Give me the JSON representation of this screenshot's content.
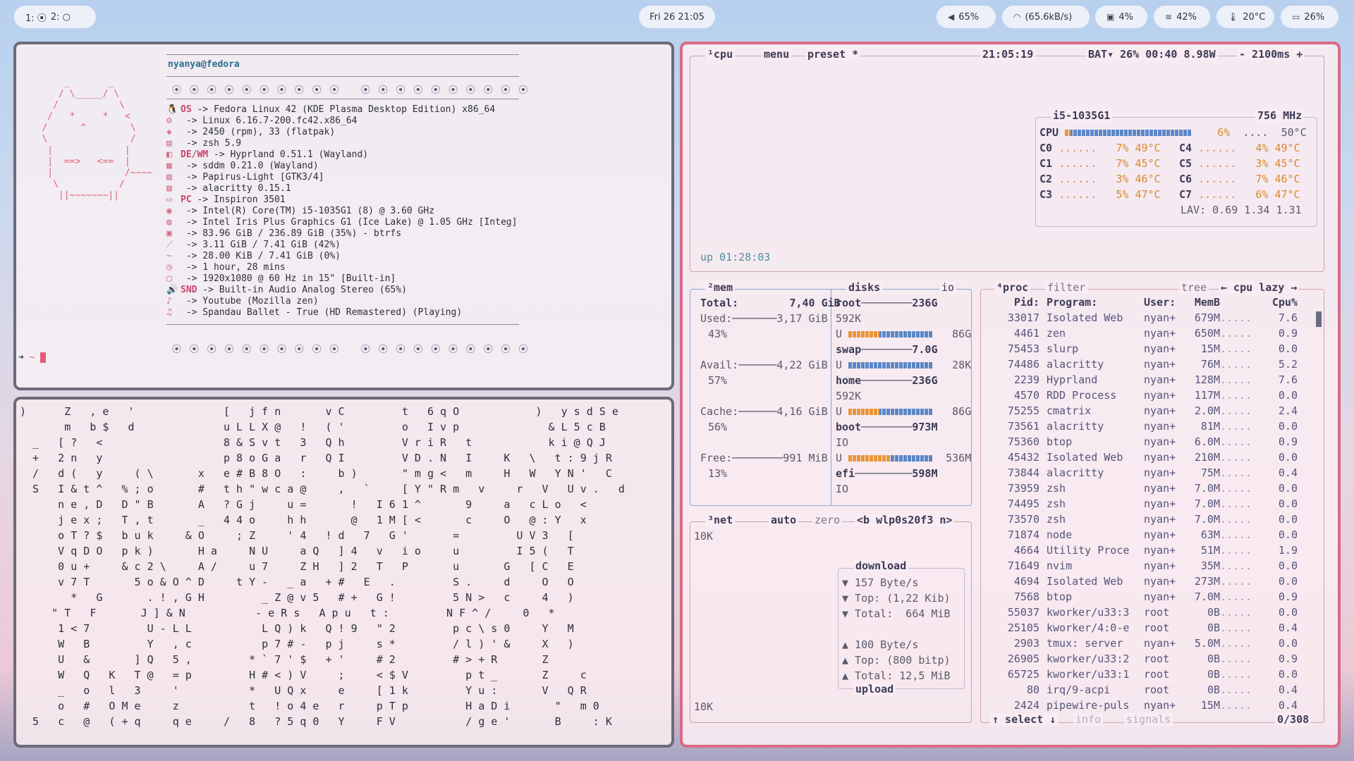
{
  "topbar": {
    "workspaces": [
      "1:",
      "2:"
    ],
    "clock": "Fri 26 21:05",
    "volume": "65%",
    "network": "(65.6kB/s)",
    "cpu": "4%",
    "memory": "42%",
    "temp": "20°C",
    "battery": "26%"
  },
  "fastfetch": {
    "user": "nyanya@fedora",
    "dots": "⦿ ⦿ ⦿ ⦿ ⦿ ⦿ ⦿ ⦿ ⦿ ⦿   ⦿ ⦿ ⦿ ⦿ ⦿ ⦿ ⦿ ⦿ ⦿ ⦿",
    "ascii": "       _       _\n      / \\_____/ \\\n     /           \\\n    /   *     *   <\n   /      ^        \\\n   \\               /\n    |             |\n    |  ==>   <==  |\n    |             /~~~~\n     \\           /\n      ||~~~~~~~||",
    "rows": [
      {
        "k": "OS",
        "v": " -> Fedora Linux 42 (KDE Plasma Desktop Edition) x86_64"
      },
      {
        "k": "",
        "v": " -> Linux 6.16.7-200.fc42.x86_64"
      },
      {
        "k": "",
        "v": " -> 2450 (rpm), 33 (flatpak)"
      },
      {
        "k": "",
        "v": " -> zsh 5.9"
      },
      {
        "k": "DE/WM",
        "v": " -> Hyprland 0.51.1 (Wayland)"
      },
      {
        "k": "",
        "v": " -> sddm 0.21.0 (Wayland)"
      },
      {
        "k": "",
        "v": " -> Papirus-Light [GTK3/4]"
      },
      {
        "k": "",
        "v": " -> alacritty 0.15.1"
      },
      {
        "k": "PC",
        "v": " -> Inspiron 3501"
      },
      {
        "k": "",
        "v": " -> Intel(R) Core(TM) i5-1035G1 (8) @ 3.60 GHz"
      },
      {
        "k": "",
        "v": " -> Intel Iris Plus Graphics G1 (Ice Lake) @ 1.05 GHz [Integ]"
      },
      {
        "k": "",
        "v": " -> 83.96 GiB / 236.89 GiB (35%) - btrfs"
      },
      {
        "k": "",
        "v": " -> 3.11 GiB / 7.41 GiB (42%)"
      },
      {
        "k": "",
        "v": " -> 28.00 KiB / 7.41 GiB (0%)"
      },
      {
        "k": "",
        "v": " -> 1 hour, 28 mins"
      },
      {
        "k": "",
        "v": " -> 1920x1080 @ 60 Hz in 15\" [Built-in]"
      },
      {
        "k": "SND",
        "v": " -> Built-in Audio Analog Stereo (65%)"
      },
      {
        "k": "",
        "v": " -> Youtube (Mozilla zen)"
      },
      {
        "k": "",
        "v": " -> Spandau Ballet - True (HD Remastered) (Playing)"
      }
    ],
    "prompt": "~"
  },
  "matrix": ")      Z   , e   '              [   j f n       v C         t   6 q O            )   y s d S e\n       m   b $   d              u L L X @   !   ( '         o   I v p              & L 5 c B\n  _   [ ?   <                   8 & S v t   3   Q h         V r i R   t            k i @ Q J\n  +   2 n   y                   p 8 o G a   r   Q I         V D . N   I     K   \\   t : 9 j R\n  /   d (   y     ( \\       x   e # B 8 O   :     b )       \" m g <   m     H   W   Y N '   C\n  S   I & t ^   % ; o       #   t h \" w c a @     ,   `     [ Y \" R m   v     r   V   U v .   d\n      n e , D   D \" B       A   ? G j     u =       !   I 6 1 ^       9     a   c L o   <\n      j e x ;   T , t       _   4 4 o     h h       @   1 M [ <       c     O   @ : Y   x\n      o T ? $   b u k     & O     ; Z     ' 4   ! d   7   G '       =         U V 3   [\n      V q D O   p k )       H a     N U     a Q   ] 4   v   i o     u         I 5 (   T\n      0 u +     & c 2 \\     A /     u 7     Z H   ] 2   T   P       u       G   [ C   E\n      v 7 T       5 o & O ^ D     t Y -   _ a   + #   E   .         S .     d     O   O\n        *   G       . ! , G H         _ Z @ v 5   # +   G !         5 N >   c     4   )\n     \" T   F       J ] & N           - e R s   A p u   t :         N F ^ /     0   *\n      1 < 7         U - L L           L Q ) k   Q ! 9   \" 2         p c \\ s 0     Y   M\n      W   B         Y   , c           p 7 # -   p j     s *         / l ) ' &     X   )\n      U   &       ] Q   5 ,         * ` 7 ' $   + '     # 2         # > + R       Z\n      W   Q   K   T @   = p         H # < ) V     ;     < $ V         p t _       Z     c\n      _   o   l   3     '           *   U Q x     e     [ 1 k         Y u :       V   Q R\n      o   #   O M e     z           t   ! o 4 e   r     p T p         H a D i       \"   m 0\n  5   c   @   ( + q     q e     /   8   ? 5 q 0   Y     F V           / g e '       B     : K",
  "btop": {
    "cpu_tab": "¹cpu",
    "menu": "menu",
    "preset": "preset *",
    "clock": "21:05:19",
    "bat": "BAT▾ 26% 00:40 8.98W",
    "interval": "- 2100ms +",
    "cpu_model": "i5-1035G1",
    "freq": "756 MHz",
    "cpu_total": {
      "label": "CPU",
      "pct": "6%",
      "temp": "50°C"
    },
    "cores": [
      {
        "n": "C0",
        "p": "7%",
        "t": "49°C"
      },
      {
        "n": "C4",
        "p": "4%",
        "t": "49°C"
      },
      {
        "n": "C1",
        "p": "7%",
        "t": "45°C"
      },
      {
        "n": "C5",
        "p": "3%",
        "t": "45°C"
      },
      {
        "n": "C2",
        "p": "3%",
        "t": "46°C"
      },
      {
        "n": "C6",
        "p": "7%",
        "t": "46°C"
      },
      {
        "n": "C3",
        "p": "5%",
        "t": "47°C"
      },
      {
        "n": "C7",
        "p": "6%",
        "t": "47°C"
      }
    ],
    "lav": "LAV: 0.69 1.34 1.31",
    "uptime": "up 01:28:03",
    "mem": {
      "tab": "²mem",
      "total_label": "Total:",
      "total": "7,40 GiB",
      "used_label": "Used:",
      "used": "3,17 GiB",
      "used_pct": "43%",
      "avail_label": "Avail:",
      "avail": "4,22 GiB",
      "avail_pct": "57%",
      "cache_label": "Cache:",
      "cache": "4,16 GiB",
      "cache_pct": "56%",
      "free_label": "Free:",
      "free": "991 MiB",
      "free_pct": "13%"
    },
    "disks": {
      "tab": "disks",
      "io": "io",
      "root": "root",
      "root_size": "236G",
      "root_io": "592K",
      "root_u": "86G",
      "swap": "swap",
      "swap_size": "7.0G",
      "swap_u": "28K",
      "home": "home",
      "home_size": "236G",
      "home_io": "592K",
      "home_u": "86G",
      "boot": "boot",
      "boot_size": "973M",
      "boot_io": "IO",
      "boot_u": "536M",
      "efi": "efi",
      "efi_size": "598M",
      "efi_io": "IO",
      "u": "U"
    },
    "net": {
      "tab": "³net",
      "auto": "auto",
      "zero": "zero",
      "iface": "<b wlp0s20f3 n>",
      "scale_top": "10K",
      "scale_bot": "10K",
      "download": "download",
      "dl_rate": "▼ 157 Byte/s",
      "dl_top": "▼ Top: (1,22 Kib)",
      "dl_total": "▼ Total:  664 MiB",
      "ul_rate": "▲ 100 Byte/s",
      "ul_top": "▲ Top: (800 bitp)",
      "ul_total": "▲ Total: 12,5 MiB",
      "upload": "upload"
    },
    "proc": {
      "tab": "⁴proc",
      "filter": "filter",
      "tree": "tree",
      "sort": "← cpu lazy →",
      "headers": [
        "Pid:",
        "Program:",
        "User:",
        "MemB",
        "Cpu%"
      ],
      "rows": [
        [
          "33017",
          "Isolated Web",
          "nyan+",
          "679M",
          "7.6"
        ],
        [
          "4461",
          "zen",
          "nyan+",
          "650M",
          "0.9"
        ],
        [
          "75453",
          "slurp",
          "nyan+",
          "15M",
          "0.0"
        ],
        [
          "74486",
          "alacritty",
          "nyan+",
          "76M",
          "5.2"
        ],
        [
          "2239",
          "Hyprland",
          "nyan+",
          "128M",
          "7.6"
        ],
        [
          "4570",
          "RDD Process",
          "nyan+",
          "117M",
          "0.0"
        ],
        [
          "75255",
          "cmatrix",
          "nyan+",
          "2.0M",
          "2.4"
        ],
        [
          "73561",
          "alacritty",
          "nyan+",
          "81M",
          "0.0"
        ],
        [
          "75360",
          "btop",
          "nyan+",
          "6.0M",
          "0.9"
        ],
        [
          "45432",
          "Isolated Web",
          "nyan+",
          "210M",
          "0.0"
        ],
        [
          "73844",
          "alacritty",
          "nyan+",
          "75M",
          "0.4"
        ],
        [
          "73959",
          "zsh",
          "nyan+",
          "7.0M",
          "0.0"
        ],
        [
          "74495",
          "zsh",
          "nyan+",
          "7.0M",
          "0.0"
        ],
        [
          "73570",
          "zsh",
          "nyan+",
          "7.0M",
          "0.0"
        ],
        [
          "71874",
          "node",
          "nyan+",
          "63M",
          "0.0"
        ],
        [
          "4664",
          "Utility Proce",
          "nyan+",
          "51M",
          "1.9"
        ],
        [
          "71649",
          "nvim",
          "nyan+",
          "35M",
          "0.0"
        ],
        [
          "4694",
          "Isolated Web",
          "nyan+",
          "273M",
          "0.0"
        ],
        [
          "7568",
          "btop",
          "nyan+",
          "7.0M",
          "0.9"
        ],
        [
          "55037",
          "kworker/u33:3",
          "root",
          "0B",
          "0.0"
        ],
        [
          "25105",
          "kworker/4:0-e",
          "root",
          "0B",
          "0.4"
        ],
        [
          "2903",
          "tmux: server",
          "nyan+",
          "5.0M",
          "0.0"
        ],
        [
          "26905",
          "kworker/u33:2",
          "root",
          "0B",
          "0.9"
        ],
        [
          "65725",
          "kworker/u33:1",
          "root",
          "0B",
          "0.0"
        ],
        [
          "80",
          "irq/9-acpi",
          "root",
          "0B",
          "0.4"
        ],
        [
          "2424",
          "pipewire-puls",
          "nyan+",
          "15M",
          "0.4"
        ]
      ],
      "select": "↑ select ↓",
      "info": "info",
      "signals": "signals",
      "count": "0/308"
    }
  }
}
